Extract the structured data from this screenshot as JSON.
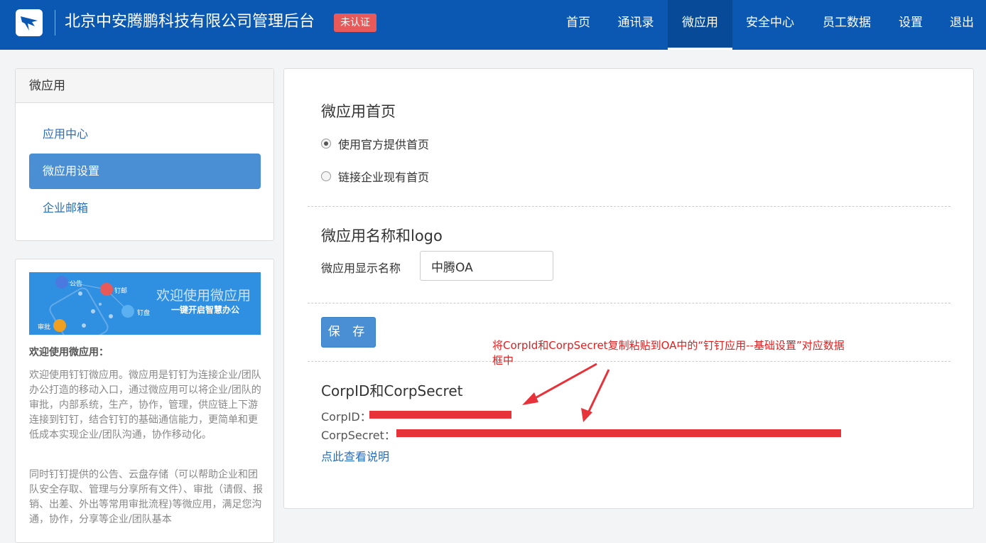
{
  "header": {
    "company_name": "北京中安腾鹏科技有限公司管理后台",
    "badge": "未认证",
    "nav": [
      {
        "label": "首页"
      },
      {
        "label": "通讯录"
      },
      {
        "label": "微应用",
        "active": true
      },
      {
        "label": "安全中心"
      },
      {
        "label": "员工数据"
      },
      {
        "label": "设置"
      },
      {
        "label": "退出"
      }
    ],
    "brand_color": "#0b58b2"
  },
  "sidebar": {
    "title": "微应用",
    "items": [
      {
        "label": "应用中心"
      },
      {
        "label": "微应用设置",
        "active": true
      },
      {
        "label": "企业邮箱"
      }
    ]
  },
  "promo": {
    "banner_title": "欢迎使用微应用",
    "banner_subtitle": "一键开启智慧办公",
    "banner_labels": [
      "公告",
      "钉邮",
      "钉盘",
      "审批"
    ],
    "heading": "欢迎使用微应用：",
    "paragraph1": "欢迎使用钉钉微应用。微应用是钉钉为连接企业/团队办公打造的移动入口，通过微应用可以将企业/团队的审批，内部系统，生产，协作，管理，供应链上下游连接到钉钉，结合钉钉的基础通信能力，更简单和更低成本实现企业/团队沟通，协作移动化。",
    "paragraph2": "同时钉钉提供的公告、云盘存储（可以帮助企业和团队安全存取、管理与分享所有文件）、审批（请假、报销、出差、外出等常用审批流程)等微应用，满足您沟通，协作，分享等企业/团队基本"
  },
  "main": {
    "homepage_section_title": "微应用首页",
    "radio_official": "使用官方提供首页",
    "radio_link": "链接企业现有首页",
    "selected_radio": "official",
    "name_section_title": "微应用名称和logo",
    "display_name_label": "微应用显示名称",
    "display_name_value": "中腾OA",
    "save_label": "保 存",
    "cred_section_title": "CorpID和CorpSecret",
    "corpid_label": "CorpID：",
    "corpsecret_label": "CorpSecret：",
    "help_link": "点此查看说明",
    "annotation": "将CorpId和CorpSecret复制粘贴到OA中的“钉钉应用--基础设置”对应数据框中"
  }
}
